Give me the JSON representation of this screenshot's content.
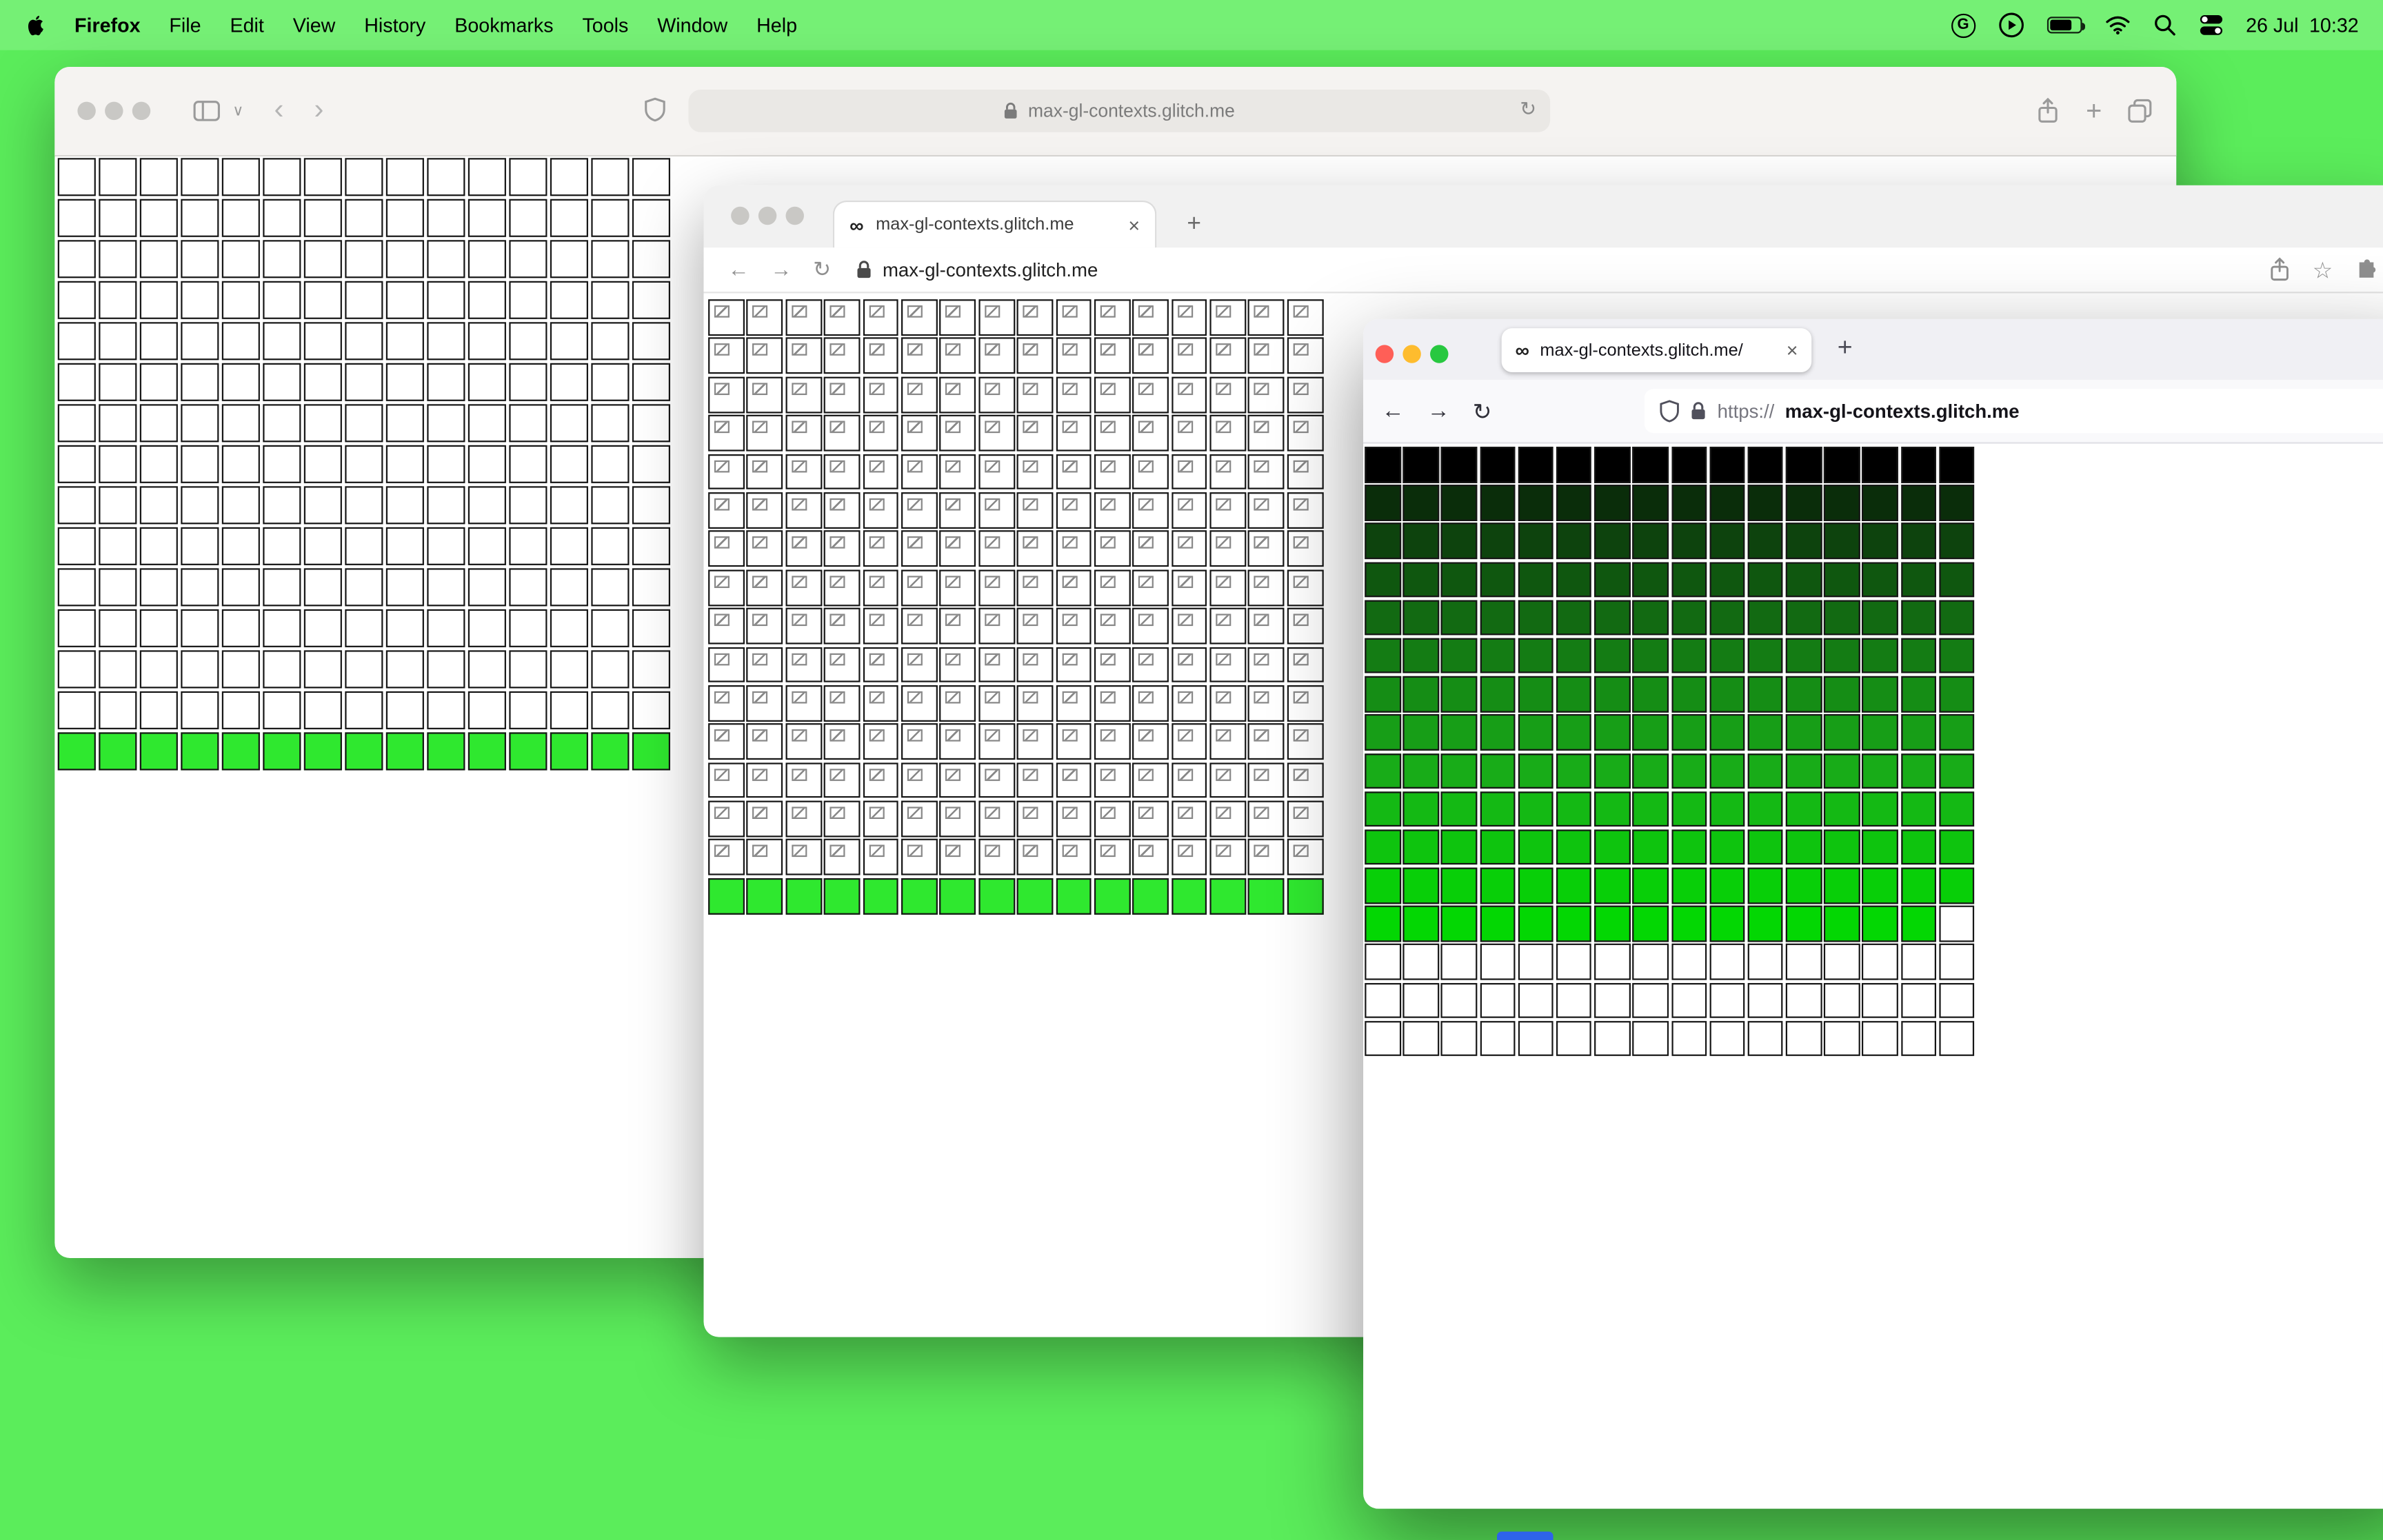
{
  "colors": {
    "desktop": "#5bed5b",
    "bright_green": "#2fe82f",
    "dock_peek": "#2e63ea",
    "traffic_close": "#ff5f57",
    "traffic_min": "#febc2e",
    "traffic_zoom": "#28c840",
    "traffic_inactive": "#c9c8c5"
  },
  "menu_bar": {
    "app_name": "Firefox",
    "items": [
      "File",
      "Edit",
      "View",
      "History",
      "Bookmarks",
      "Tools",
      "Window",
      "Help"
    ],
    "date": "26 Jul",
    "time": "10:32"
  },
  "icons": {
    "infinity": "∞",
    "close": "×",
    "plus": "+",
    "back_arrow": "←",
    "forward_arrow": "→",
    "reload": "↻",
    "back_chevron": "‹",
    "forward_chevron": "›",
    "chevron_down": "∨",
    "star": "☆",
    "grammarly_g": "G"
  },
  "window_back": {
    "url": "max-gl-contexts.glitch.me",
    "grid": {
      "cols": 15,
      "cell": 25.4,
      "gap": 1.6,
      "border": "#161616",
      "rows": [
        {
          "color": "#ffffff",
          "count": 14
        },
        {
          "color": "#2fe82f",
          "count": 1
        }
      ]
    }
  },
  "window_middle": {
    "tab_title": "max-gl-contexts.glitch.me",
    "url": "max-gl-contexts.glitch.me",
    "grid": {
      "cols": 16,
      "cell": 23.8,
      "gap": 1.6,
      "border": "#161616",
      "rows": [
        {
          "color": "#ffffff",
          "broken": true,
          "count": 15
        },
        {
          "color": "#2fe82f",
          "count": 1
        }
      ]
    }
  },
  "window_front": {
    "tab_title": "max-gl-contexts.glitch.me/",
    "url_scheme": "https://",
    "url_host": "max-gl-contexts.glitch.me",
    "grid": {
      "cols": 16,
      "cell": 23.5,
      "gap": 1.7,
      "border": "#161616",
      "rows": [
        {
          "color": "#000000"
        },
        {
          "color": "#0a2d0a"
        },
        {
          "color": "#0d430d"
        },
        {
          "color": "#0f570f"
        },
        {
          "color": "#126a12"
        },
        {
          "color": "#147c14"
        },
        {
          "color": "#158d15"
        },
        {
          "color": "#179e17"
        },
        {
          "color": "#18ac18"
        },
        {
          "color": "#14b914"
        },
        {
          "color": "#0ec40e"
        },
        {
          "color": "#08cf08"
        },
        {
          "color": "#03d703"
        },
        {
          "color": "#ffffff",
          "count": 3
        }
      ],
      "exceptions": [
        {
          "row": 12,
          "col": 15,
          "color": "#ffffff"
        }
      ]
    }
  }
}
